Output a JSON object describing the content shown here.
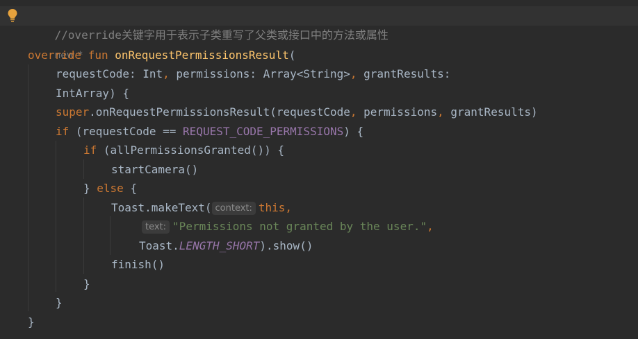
{
  "editor": {
    "comment": "//override关键字用于表示子类重写了父类或接口中的方法或属性",
    "author_hint": "new *",
    "code": {
      "l1_kw_override": "override",
      "l1_kw_fun": "fun",
      "l1_fn_name": "onRequestPermissionsResult",
      "l1_paren": "(",
      "l2_param1": "requestCode: Int",
      "l2_comma1": ",",
      "l2_param2": "permissions: Array<String>",
      "l2_comma2": ",",
      "l2_param3": "grantResults:",
      "l3_type": "IntArray) {",
      "l4_super": "super",
      "l4_call": ".onRequestPermissionsResult(requestCode",
      "l4_comma1": ",",
      "l4_arg2": "permissions",
      "l4_comma2": ",",
      "l4_arg3": "grantResults)",
      "l5_kw_if": "if",
      "l5_open": "(requestCode ==",
      "l5_const": "REQUEST_CODE_PERMISSIONS",
      "l5_close": ") {",
      "l6_kw_if": "if",
      "l6_rest": "(allPermissionsGranted()) {",
      "l7_call": "startCamera()",
      "l8_brace": "}",
      "l8_kw_else": "else",
      "l8_open": "{",
      "l9_call": "Toast.makeText(",
      "l9_hint_context": "context:",
      "l9_this": "this",
      "l9_comma": ",",
      "l10_hint_text": "text:",
      "l10_string": "\"Permissions not granted by the user.\"",
      "l10_comma": ",",
      "l11_toast": "Toast.",
      "l11_const": "LENGTH_SHORT",
      "l11_show": ").show()",
      "l12_call": "finish()",
      "l13_brace": "}",
      "l14_brace": "}",
      "l15_brace": "}"
    }
  },
  "colors": {
    "background": "#2b2b2b",
    "keyword": "#cc7832",
    "function": "#ffc66d",
    "string": "#6a8759",
    "constant": "#9876aa",
    "comment": "#808080",
    "text": "#a9b7c6",
    "bulb": "#e8a33d"
  },
  "icons": {
    "intention": "lightbulb-icon"
  }
}
